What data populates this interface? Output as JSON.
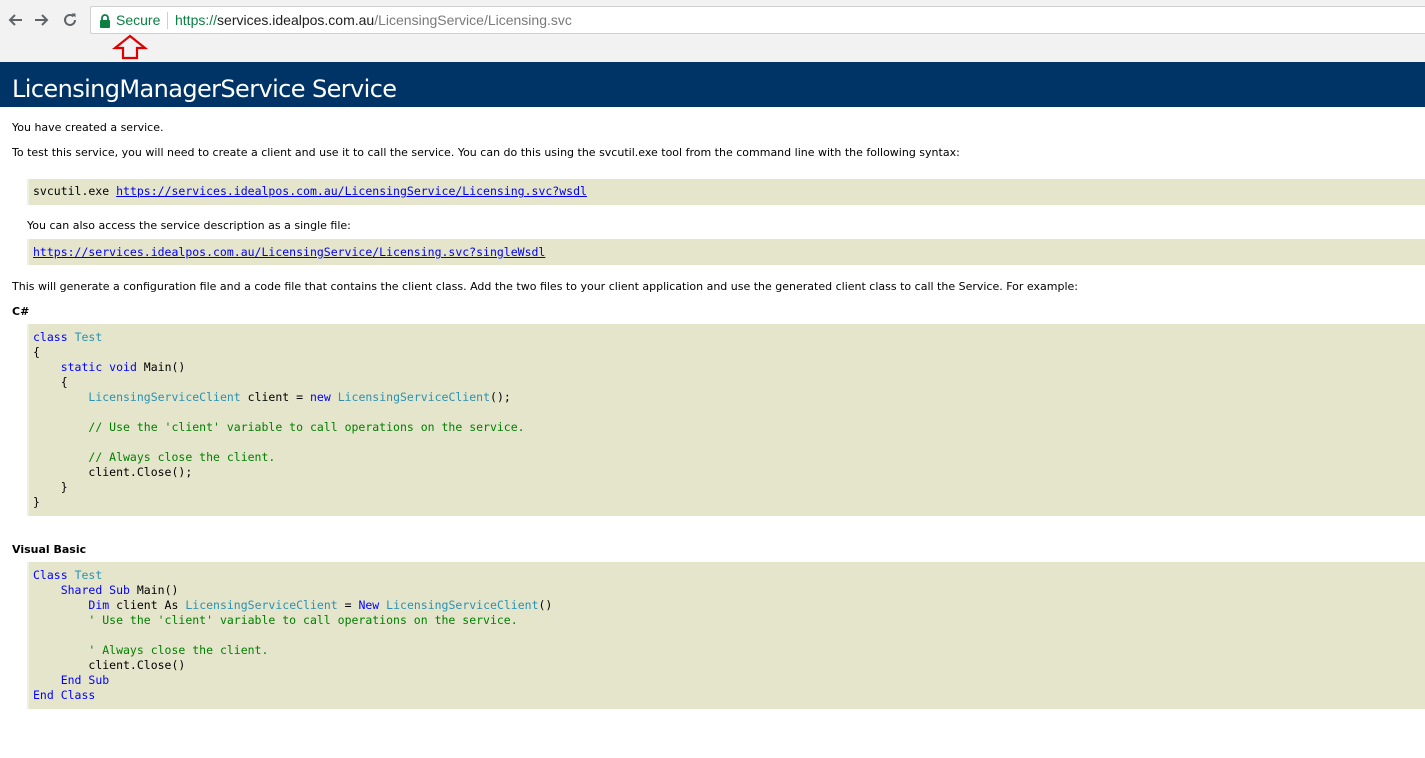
{
  "browser": {
    "secure_label": "Secure",
    "url_scheme": "https://",
    "url_host": "services.idealpos.com.au",
    "url_path": "/LicensingService/Licensing.svc",
    "icons": [
      "back-arrow-icon",
      "forward-arrow-icon",
      "reload-icon",
      "lock-icon"
    ],
    "colors": {
      "secure": "#0b8043",
      "annotation_arrow": "#e00000"
    }
  },
  "page": {
    "title": "LicensingManagerService Service",
    "intro": "You have created a service.",
    "test_instructions": "To test this service, you will need to create a client and use it to call the service. You can do this using the svcutil.exe tool from the command line with the following syntax:",
    "svcutil_command": "svcutil.exe",
    "wsdl_link": "https://services.idealpos.com.au/LicensingService/Licensing.svc?wsdl",
    "single_file_text": "You can also access the service description as a single file:",
    "single_wsdl_link": "https://services.idealpos.com.au/LicensingService/Licensing.svc?singleWsdl",
    "generate_text": "This will generate a configuration file and a code file that contains the client class. Add the two files to your client application and use the generated client class to call the Service. For example:",
    "csharp_heading": "C#",
    "vb_heading": "Visual Basic",
    "colors": {
      "banner": "#003366",
      "code_bg": "#e5e5cc",
      "keyword": "#0000ff",
      "type": "#2b91af",
      "comment": "#008000"
    }
  },
  "csharp": {
    "class_kw": "class",
    "class_name": "Test",
    "open_brace": "{",
    "static_void": "static void",
    "main_sig": " Main()",
    "inner_open": "{",
    "client_type": "LicensingServiceClient",
    "client_decl": " client = ",
    "new_kw": "new",
    "client_ctor": "LicensingServiceClient",
    "ctor_end": "();",
    "comment1": "// Use the 'client' variable to call operations on the service.",
    "comment2": "// Always close the client.",
    "close_call": "client.Close();",
    "inner_close": "}",
    "close_brace": "}"
  },
  "vb": {
    "class_kw": "Class",
    "class_name": "Test",
    "shared_sub": "Shared Sub",
    "main_sig": " Main()",
    "dim_kw": "Dim",
    "client_as": " client As ",
    "client_type": "LicensingServiceClient",
    "equals": " = ",
    "new_kw": "New",
    "client_ctor": "LicensingServiceClient",
    "ctor_end": "()",
    "comment1": "' Use the 'client' variable to call operations on the service.",
    "comment2": "' Always close the client.",
    "close_call": "client.Close()",
    "end_sub": "End Sub",
    "end_class": "End Class"
  }
}
